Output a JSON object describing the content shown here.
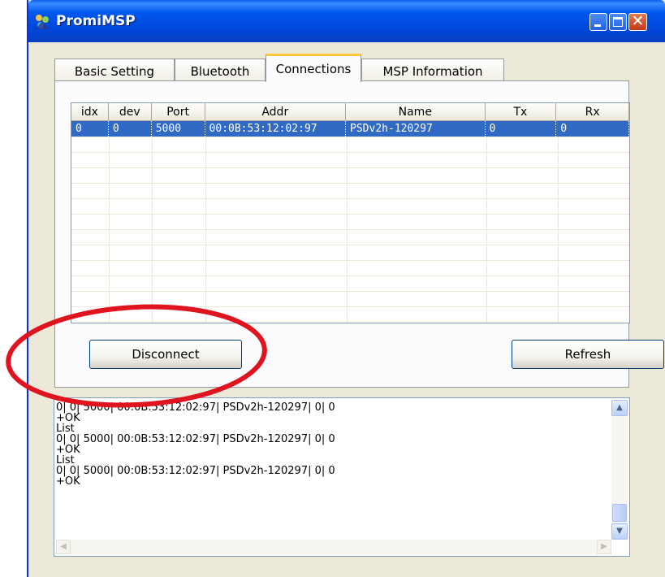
{
  "window": {
    "title": "PromiMSP"
  },
  "tabs": [
    {
      "label": "Basic Setting"
    },
    {
      "label": "Bluetooth"
    },
    {
      "label": "Connections"
    },
    {
      "label": "MSP Information"
    }
  ],
  "active_tab": "Connections",
  "table": {
    "columns": [
      "idx",
      "dev",
      "Port",
      "Addr",
      "Name",
      "Tx",
      "Rx"
    ],
    "rows": [
      {
        "idx": "0",
        "dev": "0",
        "port": "5000",
        "addr": "00:0B:53:12:02:97",
        "name": "PSDv2h-120297",
        "tx": "0",
        "rx": "0",
        "selected": true
      }
    ]
  },
  "buttons": {
    "disconnect": "Disconnect",
    "refresh": "Refresh"
  },
  "log": {
    "lines": [
      "0| 0| 5000| 00:0B:53:12:02:97| PSDv2h-120297| 0| 0",
      "+OK",
      "List",
      "0| 0| 5000| 00:0B:53:12:02:97| PSDv2h-120297| 0| 0",
      "+OK",
      "List",
      "0| 0| 5000| 00:0B:53:12:02:97| PSDv2h-120297| 0| 0",
      "+OK"
    ]
  },
  "colors": {
    "selection": "#316AC5",
    "annotation": "#E0141E",
    "titlebar": "#0058EE",
    "window_bg": "#ECE9D8"
  }
}
